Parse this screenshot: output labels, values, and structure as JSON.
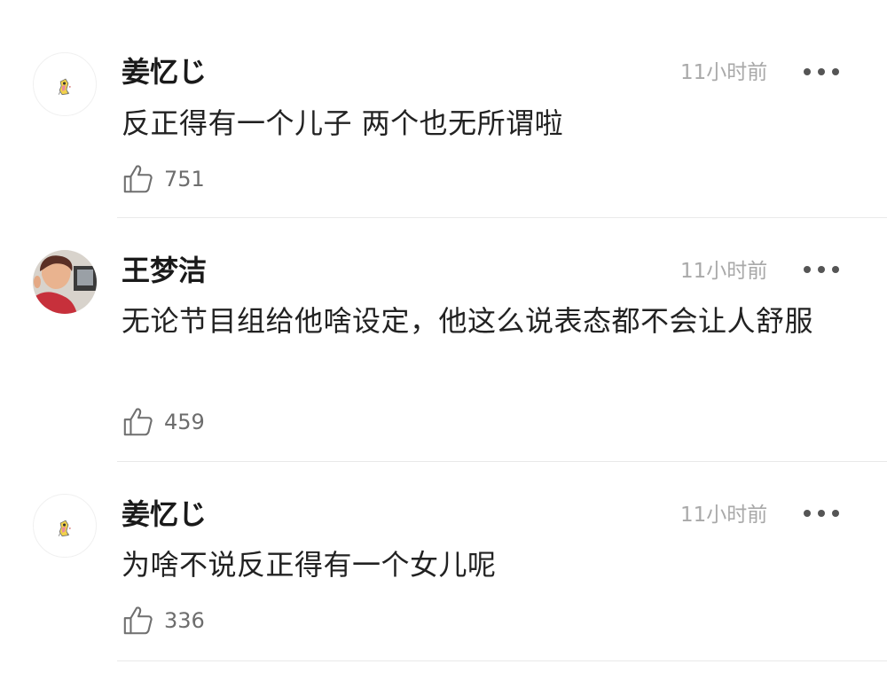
{
  "colors": {
    "background": "#ffffff",
    "name": "#1a1a1a",
    "text": "#222222",
    "time": "#a9a9a9",
    "like_count": "#6d6d6d",
    "divider": "#e9e9e9"
  },
  "comments": [
    {
      "username": "姜忆じ",
      "avatar": "sticker-avatar",
      "time": "11小时前",
      "text": "反正得有一个儿子 两个也无所谓啦",
      "like_icon": "thumbs-up-icon",
      "likes": "751",
      "more_icon": "more-options-icon"
    },
    {
      "username": "王梦洁",
      "avatar": "photo-avatar",
      "time": "11小时前",
      "text": "无论节目组给他啥设定，他这么说表态都不会让人舒服",
      "like_icon": "thumbs-up-icon",
      "likes": "459",
      "more_icon": "more-options-icon"
    },
    {
      "username": "姜忆じ",
      "avatar": "sticker-avatar",
      "time": "11小时前",
      "text": "为啥不说反正得有一个女儿呢",
      "like_icon": "thumbs-up-icon",
      "likes": "336",
      "more_icon": "more-options-icon"
    }
  ]
}
